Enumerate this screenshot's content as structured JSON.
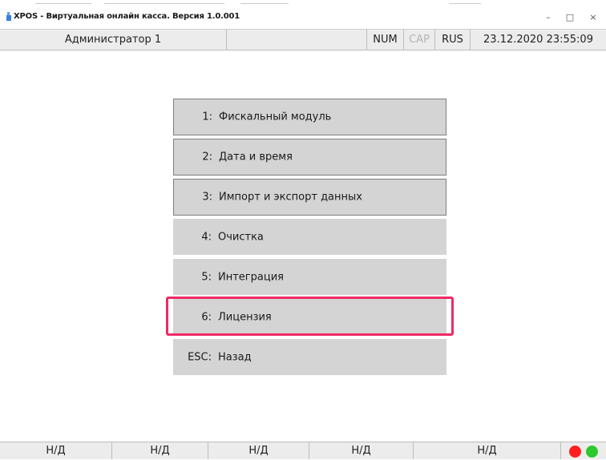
{
  "window": {
    "title": "XPOS - Виртуальная онлайн касса. Версия 1.0.001",
    "minimize_glyph": "–",
    "maximize_glyph": "□",
    "close_glyph": "×"
  },
  "status_bar": {
    "user": "Администратор 1",
    "num": "NUM",
    "cap": "CAP",
    "lang": "RUS",
    "datetime": "23.12.2020 23:55:09"
  },
  "menu": {
    "items": [
      {
        "key": "1:",
        "label": "Фискальный модуль"
      },
      {
        "key": "2:",
        "label": "Дата и время"
      },
      {
        "key": "3:",
        "label": "Импорт и экспорт данных"
      },
      {
        "key": "4:",
        "label": "Очистка"
      },
      {
        "key": "5:",
        "label": "Интеграция"
      },
      {
        "key": "6:",
        "label": "Лицензия"
      },
      {
        "key": "ESC:",
        "label": "Назад"
      }
    ]
  },
  "bottom_bar": {
    "cells": [
      "Н/Д",
      "Н/Д",
      "Н/Д",
      "Н/Д",
      "Н/Д"
    ]
  },
  "colors": {
    "highlight": "#ee2a67",
    "led_red": "#ff1f1f",
    "led_green": "#2cc82c",
    "cap_disabled": "#b4b4b4"
  },
  "icons": [
    "app-icon",
    "minimize-icon",
    "maximize-icon",
    "close-icon",
    "status-led-red-icon",
    "status-led-green-icon"
  ]
}
